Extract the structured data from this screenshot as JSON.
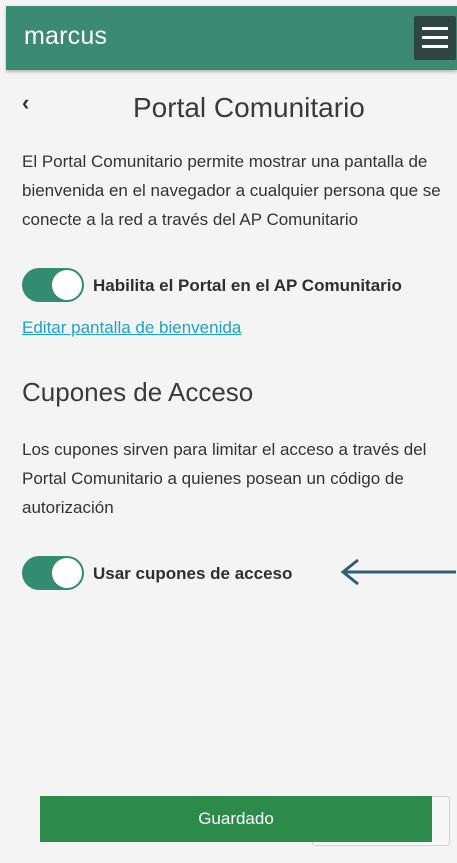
{
  "header": {
    "brand": "marcus",
    "menu_icon": "hamburger-menu-icon",
    "color": "#3a8b72"
  },
  "page": {
    "back_icon": "chevron-left-icon",
    "back_glyph": "‹",
    "title": "Portal Comunitario",
    "description": "El Portal Comunitario permite mostrar una pantalla de bienvenida en el navegador a cualquier persona que se conecte a la red a través del AP Comunitario"
  },
  "portal_toggle": {
    "label": "Habilita el Portal en el AP Comunitario",
    "enabled": true
  },
  "edit_link": {
    "label": "Editar pantalla de bienvenida",
    "color": "#1ea3c8"
  },
  "coupons": {
    "title": "Cupones de Acceso",
    "description": "Los cupones sirven para limitar el acceso a través del Portal Comunitario a quienes posean un código de autorización",
    "toggle_label": "Usar cupones de acceso",
    "enabled": true
  },
  "annotation": {
    "arrow_icon": "left-arrow-icon",
    "color": "#2d5f7a"
  },
  "footer": {
    "save_label": "Guardado",
    "save_color": "#2c8a4a"
  }
}
